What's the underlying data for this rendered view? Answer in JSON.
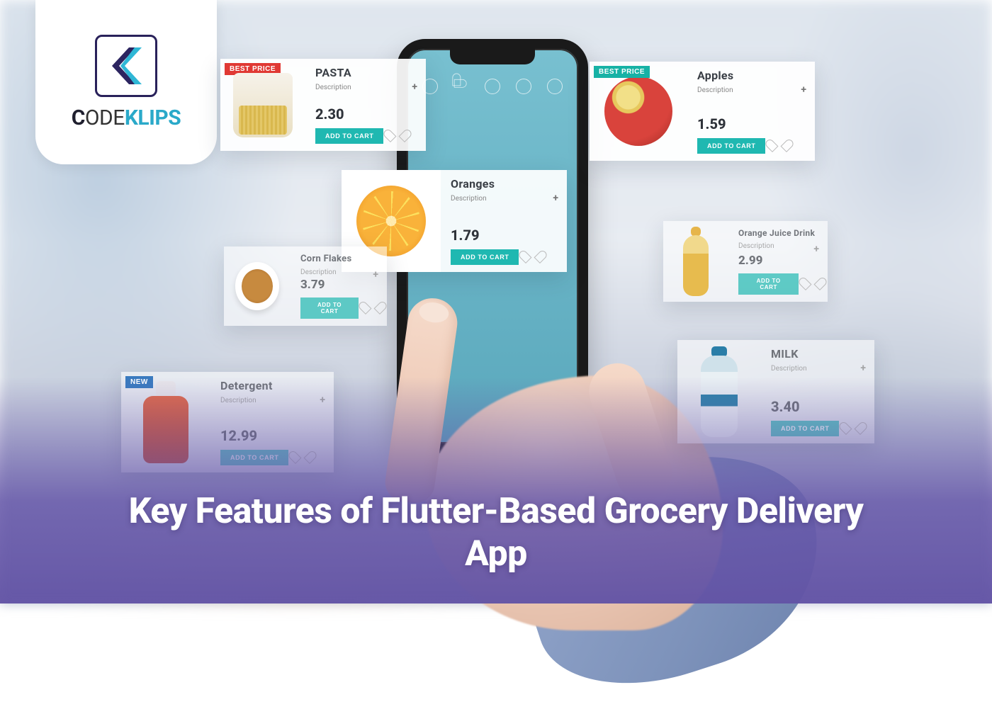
{
  "logo": {
    "brand_part1": "C",
    "brand_part2": "ODE",
    "brand_part3": "KLIPS"
  },
  "headline": "Key Features of Flutter-Based Grocery Delivery App",
  "add_to_cart_label": "ADD TO CART",
  "badges": {
    "best_price": "BEST PRICE",
    "new": "NEW"
  },
  "desc_label": "Description",
  "products": {
    "pasta": {
      "name": "PASTA",
      "price": "2.30",
      "badge": "best_price",
      "badge_color": "red"
    },
    "apples": {
      "name": "Apples",
      "price": "1.59",
      "badge": "best_price",
      "badge_color": "teal"
    },
    "oranges": {
      "name": "Oranges",
      "price": "1.79"
    },
    "cornflakes": {
      "name": "Corn Flakes",
      "price": "3.79"
    },
    "juice": {
      "name": "Orange Juice Drink",
      "price": "2.99"
    },
    "detergent": {
      "name": "Detergent",
      "price": "12.99",
      "badge": "new",
      "badge_color": "blue"
    },
    "milk": {
      "name": "MILK",
      "price": "3.40"
    }
  }
}
